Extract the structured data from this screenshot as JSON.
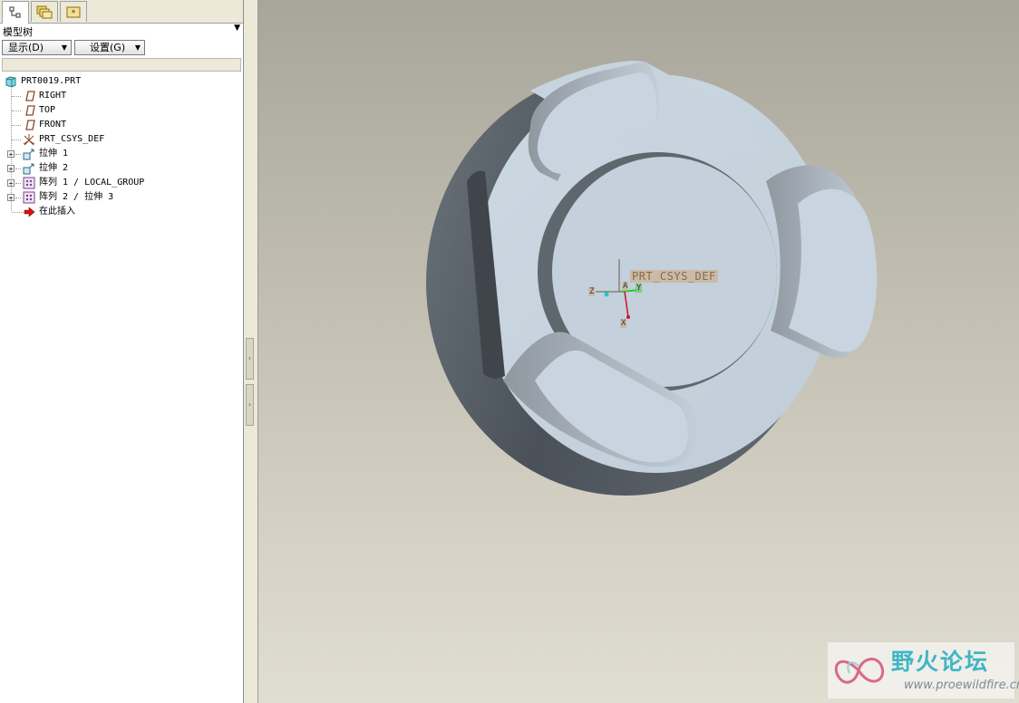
{
  "navigator": {
    "tabs": [
      {
        "name": "model-tree-tab",
        "icon": "model-tree-icon",
        "active": true
      },
      {
        "name": "folder-browser-tab",
        "icon": "folder-icon",
        "active": false
      },
      {
        "name": "favorites-tab",
        "icon": "favorites-icon",
        "active": false
      }
    ],
    "title": "模型树",
    "menu_arrow": "▼",
    "show_button": "显示(D)",
    "settings_button": "设置(G)",
    "caret": "▼"
  },
  "tree": {
    "root": "PRT0019.PRT",
    "items": [
      {
        "label": "RIGHT",
        "icon": "datum-plane-icon",
        "expandable": false
      },
      {
        "label": "TOP",
        "icon": "datum-plane-icon",
        "expandable": false
      },
      {
        "label": "FRONT",
        "icon": "datum-plane-icon",
        "expandable": false
      },
      {
        "label": "PRT_CSYS_DEF",
        "icon": "coordinate-system-icon",
        "expandable": false
      },
      {
        "label": "拉伸 1",
        "icon": "extrude-icon",
        "expandable": true
      },
      {
        "label": "拉伸 2",
        "icon": "extrude-icon",
        "expandable": true
      },
      {
        "label": "阵列 1 / LOCAL_GROUP",
        "icon": "pattern-icon",
        "expandable": true
      },
      {
        "label": "阵列 2 / 拉伸 3",
        "icon": "pattern-icon",
        "expandable": true
      },
      {
        "label": "在此插入",
        "icon": "insert-here-arrow-icon",
        "expandable": false
      }
    ],
    "expander_symbol": "+"
  },
  "splitter": {
    "collapse_symbol": "‹",
    "expand_symbol": "›"
  },
  "viewport": {
    "csys_label": "PRT_CSYS_DEF",
    "axis_z": "Z",
    "axis_x": "X",
    "axis_y": "Y",
    "origin_marker": "A"
  },
  "watermark": {
    "title": "野火论坛",
    "url": "www.proewildfire.cn"
  },
  "colors": {
    "model_face": "#c5d2dd",
    "model_side": "#565d64",
    "viewport_top": "#a8a59a",
    "viewport_bottom": "#e0ddd1",
    "watermark_accent": "#3fb6c4"
  }
}
